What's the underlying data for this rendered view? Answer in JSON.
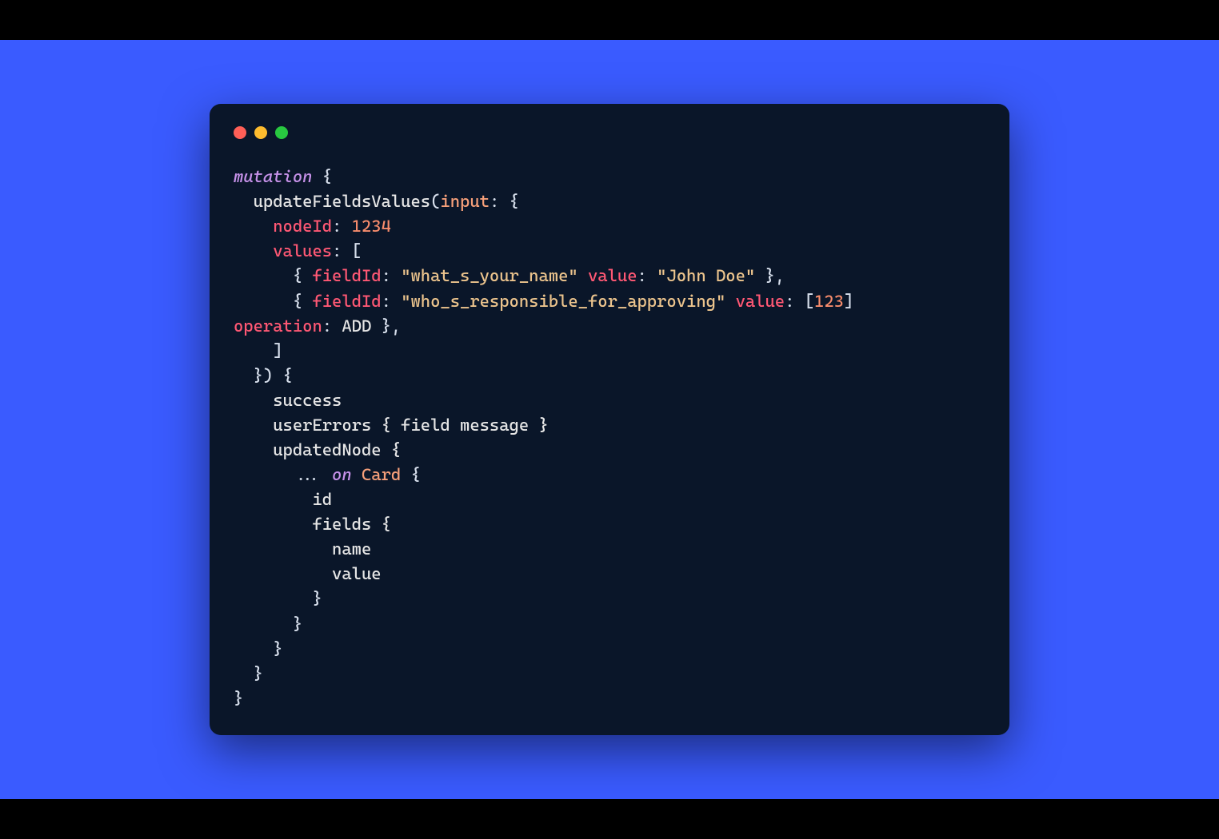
{
  "colors": {
    "background_outer": "#000",
    "background_panel": "#3a5bff",
    "window_bg": "#0a1629",
    "traffic_red": "#ff5f57",
    "traffic_yellow": "#febc2e",
    "traffic_green": "#28c840"
  },
  "code": {
    "l1_kw": "mutation",
    "l1_br": " {",
    "l2_indent": "  ",
    "l2_fn": "updateFieldsValues",
    "l2_op": "(",
    "l2_param": "input",
    "l2_colon": ": {",
    "l3_indent": "    ",
    "l3_prop": "nodeId",
    "l3_colon": ": ",
    "l3_num": "1234",
    "l4_indent": "    ",
    "l4_prop": "values",
    "l4_colon": ": [",
    "l5_indent": "      { ",
    "l5_prop1": "fieldId",
    "l5_colon1": ": ",
    "l5_str1": "\"what_s_your_name\"",
    "l5_sp1": " ",
    "l5_prop2": "value",
    "l5_colon2": ": ",
    "l5_str2": "\"John Doe\"",
    "l5_end": " },",
    "l6_indent": "      { ",
    "l6_prop1": "fieldId",
    "l6_colon1": ": ",
    "l6_str1": "\"who_s_responsible_for_approving\"",
    "l6_sp1": " ",
    "l6_prop2": "value",
    "l6_colon2": ": [",
    "l6_num": "123",
    "l6_cb": "] ",
    "l7_prop": "operation",
    "l7_colon": ": ",
    "l7_val": "ADD",
    "l7_end": " },",
    "l8": "    ]",
    "l9": "  }) {",
    "l10_indent": "    ",
    "l10_txt": "success",
    "l11_indent": "    ",
    "l11_txt": "userErrors { field message }",
    "l12_indent": "    ",
    "l12_txt": "updatedNode {",
    "l13_indent": "      ... ",
    "l13_kw": "on",
    "l13_sp": " ",
    "l13_type": "Card",
    "l13_br": " {",
    "l14": "        id",
    "l15": "        fields {",
    "l16": "          name",
    "l17": "          value",
    "l18": "        }",
    "l19": "      }",
    "l20": "    }",
    "l21": "  }",
    "l22": "}"
  }
}
